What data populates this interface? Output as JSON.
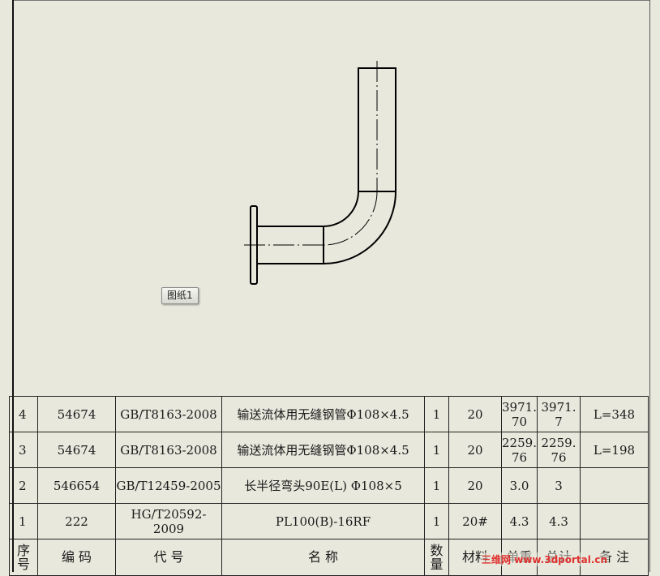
{
  "sheet_tab": {
    "label": "图纸1"
  },
  "bom": {
    "rows": [
      {
        "seq": "4",
        "code": "54674",
        "std": "GB/T8163-2008",
        "name": "输送流体用无缝钢管Φ108×4.5",
        "qty": "1",
        "material": "20",
        "unit_weight": "3971.70",
        "total_weight": "3971.7",
        "remark": "L=348"
      },
      {
        "seq": "3",
        "code": "54674",
        "std": "GB/T8163-2008",
        "name": "输送流体用无缝钢管Φ108×4.5",
        "qty": "1",
        "material": "20",
        "unit_weight": "2259.76",
        "total_weight": "2259.76",
        "remark": "L=198"
      },
      {
        "seq": "2",
        "code": "546654",
        "std": "GB/T12459-2005",
        "name": "长半径弯头90E(L)  Φ108×5",
        "qty": "1",
        "material": "20",
        "unit_weight": "3.0",
        "total_weight": "3",
        "remark": ""
      },
      {
        "seq": "1",
        "code": "222",
        "std": "HG/T20592-2009",
        "name": "PL100(B)-16RF",
        "qty": "1",
        "material": "20#",
        "unit_weight": "4.3",
        "total_weight": "4.3",
        "remark": ""
      }
    ],
    "headers": {
      "seq": "序号",
      "code": "编  码",
      "std": "代  号",
      "name": "名    称",
      "qty": "数量",
      "material": "材料",
      "unit_weight": "单重",
      "total_weight": "总计",
      "remark": "备 注"
    }
  },
  "watermark": {
    "text": "三维网 www.3dportal.cn"
  }
}
